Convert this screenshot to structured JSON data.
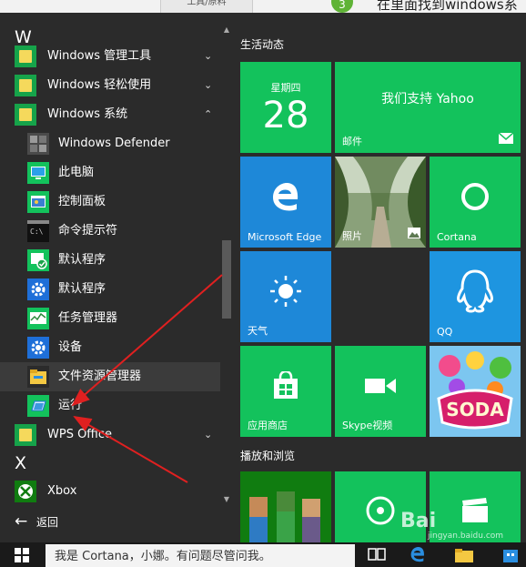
{
  "top": {
    "tab_label": "工具/原料",
    "step_num": "3",
    "headline": "在里面找到windows系"
  },
  "applist": {
    "letters": {
      "w": "W",
      "x": "X"
    },
    "items": [
      {
        "label": "Windows 管理工具",
        "icon": "folder-icon",
        "chevron": "⌄"
      },
      {
        "label": "Windows 轻松使用",
        "icon": "folder-icon",
        "chevron": "⌄"
      },
      {
        "label": "Windows 系统",
        "icon": "folder-icon",
        "chevron": "⌃"
      },
      {
        "label": "Windows Defender",
        "icon": "defender-icon"
      },
      {
        "label": "此电脑",
        "icon": "computer-icon"
      },
      {
        "label": "控制面板",
        "icon": "control-panel-icon"
      },
      {
        "label": "命令提示符",
        "icon": "cmd-icon"
      },
      {
        "label": "默认程序",
        "icon": "default-programs-icon"
      },
      {
        "label": "默认程序",
        "icon": "gear-icon"
      },
      {
        "label": "任务管理器",
        "icon": "task-manager-icon"
      },
      {
        "label": "设备",
        "icon": "gear-icon"
      },
      {
        "label": "文件资源管理器",
        "icon": "file-explorer-icon"
      },
      {
        "label": "运行",
        "icon": "run-icon"
      },
      {
        "label": "WPS Office",
        "icon": "folder-icon",
        "chevron": "⌄"
      },
      {
        "label": "Xbox",
        "icon": "xbox-icon"
      }
    ],
    "back_label": "返回"
  },
  "tiles": {
    "group1": "生活动态",
    "group2": "播放和浏览",
    "calendar": {
      "weekday": "星期四",
      "day": "28"
    },
    "mail": {
      "headline": "我们支持 Yahoo",
      "label": "邮件"
    },
    "edge": "Microsoft Edge",
    "photos": "照片",
    "cortana": "Cortana",
    "weather": "天气",
    "qq": "QQ",
    "store": "应用商店",
    "skype": "Skype视频",
    "candy": "SODA"
  },
  "taskbar": {
    "search_placeholder": "我是 Cortana，小娜。有问题尽管问我。"
  },
  "watermark": {
    "brand": "Bai",
    "site": "jingyan.baidu.com"
  },
  "colors": {
    "tile_green": "#13c25c",
    "tile_blue": "#1e88d8",
    "annotation": "#e02020"
  }
}
